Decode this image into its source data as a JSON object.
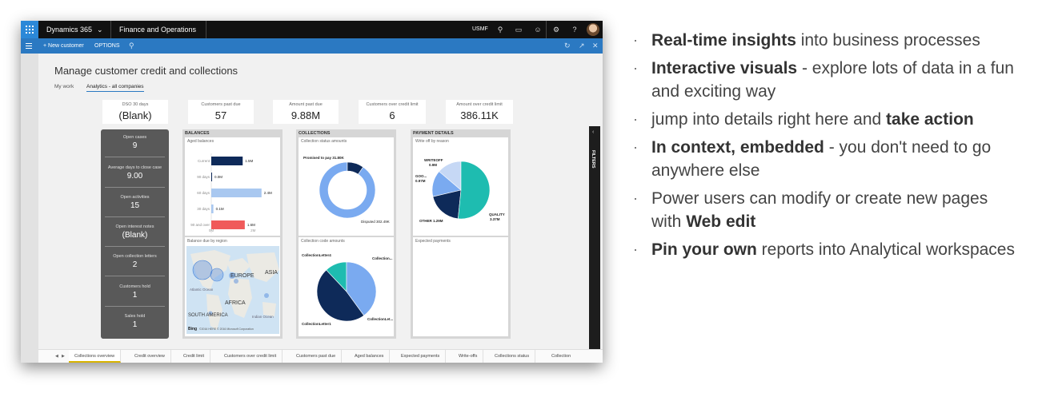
{
  "topbar": {
    "app_name": "Dynamics 365",
    "module": "Finance and Operations",
    "company": "USMF"
  },
  "actionbar": {
    "new_customer": "+ New customer",
    "options": "OPTIONS"
  },
  "workspace": {
    "title": "Manage customer credit and collections",
    "tabs": [
      "My work",
      "Analytics - all companies"
    ]
  },
  "kpis": [
    {
      "label": "DSO 30 days",
      "value": "(Blank)"
    },
    {
      "label": "Customers past due",
      "value": "57"
    },
    {
      "label": "Amount past due",
      "value": "9.88M"
    },
    {
      "label": "Customers over credit limit",
      "value": "6"
    },
    {
      "label": "Amount over credit limit",
      "value": "386.11K"
    }
  ],
  "stats": [
    {
      "label": "Open cases",
      "value": "9"
    },
    {
      "label": "Average days to close case",
      "value": "9.00"
    },
    {
      "label": "Open activities",
      "value": "15"
    },
    {
      "label": "Open interest notes",
      "value": "(Blank)"
    },
    {
      "label": "Open collection letters",
      "value": "2"
    },
    {
      "label": "Customers hold",
      "value": "1"
    },
    {
      "label": "Sales hold",
      "value": "1"
    }
  ],
  "balances": {
    "header": "BALANCES",
    "aged_title": "Aged balances",
    "region_title": "Balance due by region",
    "bars": [
      {
        "label": "Current",
        "value": 1.5,
        "text": "1.5M",
        "color": "#0e2a59"
      },
      {
        "label": "90 days",
        "value": 0.0,
        "text": "0.0M",
        "color": "#0e2a59"
      },
      {
        "label": "60 days",
        "value": 2.4,
        "text": "2.4M",
        "color": "#a9c8f0"
      },
      {
        "label": "30 days",
        "value": 0.1,
        "text": "0.1M",
        "color": "#a9c8f0"
      },
      {
        "label": "90 and over",
        "value": 1.6,
        "text": "1.6M",
        "color": "#f05a5a"
      }
    ],
    "axis_ticks": [
      "0M",
      "2M"
    ],
    "map_labels": [
      "EUROPE",
      "ASIA",
      "AFRICA",
      "SOUTH AMERICA",
      "Atlantic Ocean",
      "Indian Ocean"
    ],
    "map_credit": "©2016 HERE © 2016 Microsoft Corporation",
    "map_logo": "Bing"
  },
  "collections": {
    "header": "COLLECTIONS",
    "status_title": "Collection status amounts",
    "code_title": "Collection code amounts",
    "donut": [
      {
        "label": "Promised to pay",
        "text": "Promised to pay 31.80K",
        "value": 31.8,
        "color": "#0e2a59"
      },
      {
        "label": "Disputed",
        "text": "Disputed 302.49K",
        "value": 302.49,
        "color": "#7aaaf0"
      }
    ],
    "pie_labels": [
      "CollectionLetter4",
      "Collection...",
      "CollectionLet...",
      "CollectionLetter1"
    ],
    "pie": [
      {
        "value": 40,
        "color": "#7aaaf0"
      },
      {
        "value": 48,
        "color": "#0e2a59"
      },
      {
        "value": 12,
        "color": "#1ebcb0"
      }
    ]
  },
  "payments": {
    "header": "PAYMENT DETAILS",
    "writeoff_title": "Write off by reason",
    "expected_title": "Expected payments",
    "labels": [
      {
        "name": "WRITEOFF",
        "value": "0.9M"
      },
      {
        "name": "GOO...",
        "value": "0.97M"
      },
      {
        "name": "OTHER",
        "value": "1.29M"
      },
      {
        "name": "QUALITY",
        "value": "3.37M"
      }
    ],
    "pie": [
      {
        "value": 3.37,
        "color": "#1ebcb0"
      },
      {
        "value": 1.29,
        "color": "#0e2a59"
      },
      {
        "value": 0.97,
        "color": "#7aaaf0"
      },
      {
        "value": 0.9,
        "color": "#c6d8f5"
      }
    ]
  },
  "filters_label": "FILTERS",
  "bottom_tabs": [
    "Collections overview",
    "Credit overview",
    "Credit limit",
    "Customers over credit limit",
    "Customers past due",
    "Aged balances",
    "Expected payments",
    "Write-offs",
    "Collections status",
    "Collection"
  ],
  "bullets": [
    {
      "bold": "Real-time insights",
      "text": " into business processes"
    },
    {
      "bold": "Interactive visuals",
      "text": " - explore lots of data in a fun and exciting way"
    },
    {
      "pre": "jump into details right here and ",
      "bold": "take action",
      "text": ""
    },
    {
      "bold": "In context, embedded",
      "text": " - you don't need to go anywhere else"
    },
    {
      "pre": "Power users can modify or create new pages with ",
      "bold": "Web edit",
      "text": ""
    },
    {
      "bold": "Pin your own",
      "text": " reports into Analytical workspaces"
    }
  ]
}
